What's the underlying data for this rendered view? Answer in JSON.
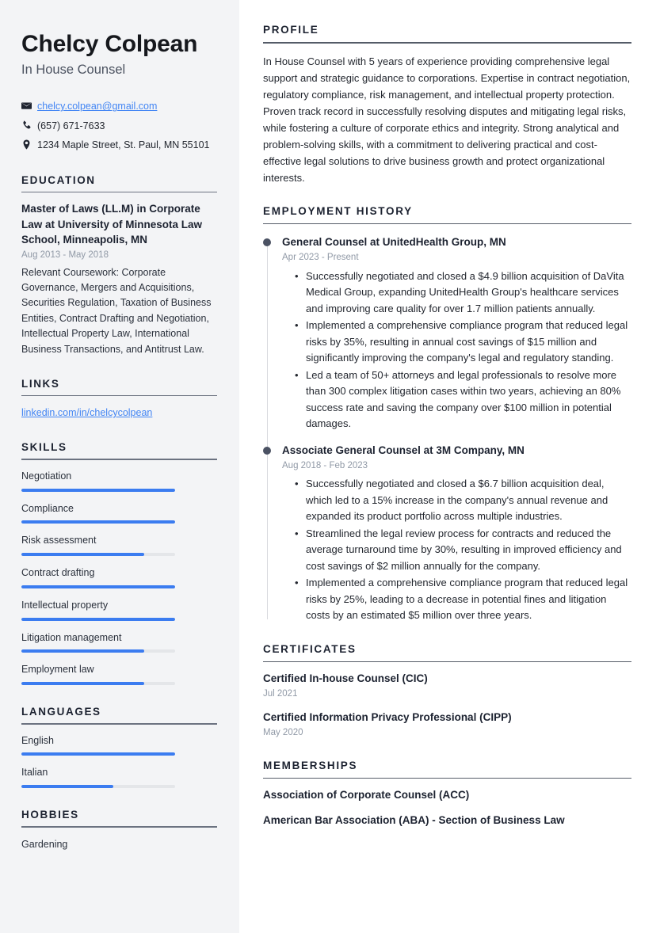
{
  "theme": {
    "sidebar_bg": "#f3f4f6",
    "accent_blue": "#3b7cf0",
    "link_blue": "#4285f4",
    "heading_color": "#1c2230",
    "muted_color": "#9099a6",
    "timeline_dot": "#4b5263"
  },
  "header": {
    "name": "Chelcy Colpean",
    "job_title": "In House Counsel"
  },
  "contact": {
    "email": "chelcy.colpean@gmail.com",
    "phone": "(657) 671-7633",
    "address": "1234 Maple Street, St. Paul, MN 55101"
  },
  "education": {
    "heading": "EDUCATION",
    "items": [
      {
        "title": "Master of Laws (LL.M) in Corporate Law at University of Minnesota Law School, Minneapolis, MN",
        "date": "Aug 2013 - May 2018",
        "description": "Relevant Coursework: Corporate Governance, Mergers and Acquisitions, Securities Regulation, Taxation of Business Entities, Contract Drafting and Negotiation, Intellectual Property Law, International Business Transactions, and Antitrust Law."
      }
    ]
  },
  "links": {
    "heading": "LINKS",
    "items": [
      {
        "label": "linkedin.com/in/chelcycolpean"
      }
    ]
  },
  "skills": {
    "heading": "SKILLS",
    "items": [
      {
        "label": "Negotiation",
        "level": 100
      },
      {
        "label": "Compliance",
        "level": 100
      },
      {
        "label": "Risk assessment",
        "level": 80
      },
      {
        "label": "Contract drafting",
        "level": 100
      },
      {
        "label": "Intellectual property",
        "level": 100
      },
      {
        "label": "Litigation management",
        "level": 80
      },
      {
        "label": "Employment law",
        "level": 80
      }
    ]
  },
  "languages": {
    "heading": "LANGUAGES",
    "items": [
      {
        "label": "English",
        "level": 100
      },
      {
        "label": "Italian",
        "level": 60
      }
    ]
  },
  "hobbies": {
    "heading": "HOBBIES",
    "items": [
      {
        "label": "Gardening"
      }
    ]
  },
  "profile": {
    "heading": "PROFILE",
    "text": "In House Counsel with 5 years of experience providing comprehensive legal support and strategic guidance to corporations. Expertise in contract negotiation, regulatory compliance, risk management, and intellectual property protection. Proven track record in successfully resolving disputes and mitigating legal risks, while fostering a culture of corporate ethics and integrity. Strong analytical and problem-solving skills, with a commitment to delivering practical and cost-effective legal solutions to drive business growth and protect organizational interests."
  },
  "employment": {
    "heading": "EMPLOYMENT HISTORY",
    "jobs": [
      {
        "role": "General Counsel at UnitedHealth Group, MN",
        "date": "Apr 2023 - Present",
        "bullets": [
          "Successfully negotiated and closed a $4.9 billion acquisition of DaVita Medical Group, expanding UnitedHealth Group's healthcare services and improving care quality for over 1.7 million patients annually.",
          "Implemented a comprehensive compliance program that reduced legal risks by 35%, resulting in annual cost savings of $15 million and significantly improving the company's legal and regulatory standing.",
          "Led a team of 50+ attorneys and legal professionals to resolve more than 300 complex litigation cases within two years, achieving an 80% success rate and saving the company over $100 million in potential damages."
        ]
      },
      {
        "role": "Associate General Counsel at 3M Company, MN",
        "date": "Aug 2018 - Feb 2023",
        "bullets": [
          "Successfully negotiated and closed a $6.7 billion acquisition deal, which led to a 15% increase in the company's annual revenue and expanded its product portfolio across multiple industries.",
          "Streamlined the legal review process for contracts and reduced the average turnaround time by 30%, resulting in improved efficiency and cost savings of $2 million annually for the company.",
          "Implemented a comprehensive compliance program that reduced legal risks by 25%, leading to a decrease in potential fines and litigation costs by an estimated $5 million over three years."
        ]
      }
    ]
  },
  "certificates": {
    "heading": "CERTIFICATES",
    "items": [
      {
        "title": "Certified In-house Counsel (CIC)",
        "date": "Jul 2021"
      },
      {
        "title": "Certified Information Privacy Professional (CIPP)",
        "date": "May 2020"
      }
    ]
  },
  "memberships": {
    "heading": "MEMBERSHIPS",
    "items": [
      {
        "title": "Association of Corporate Counsel (ACC)"
      },
      {
        "title": "American Bar Association (ABA) - Section of Business Law"
      }
    ]
  }
}
